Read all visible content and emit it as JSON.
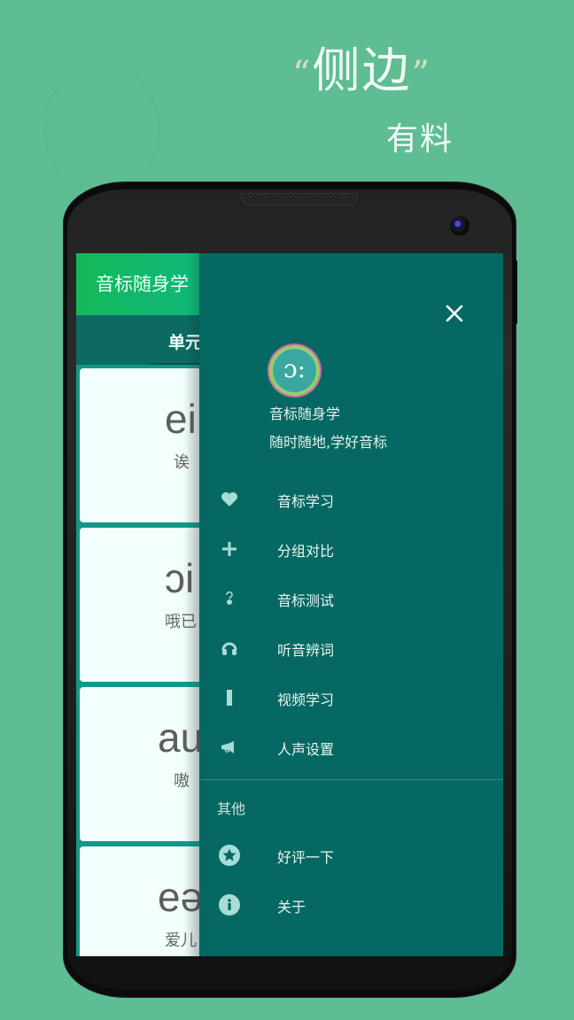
{
  "promo": {
    "open_quote": "“",
    "headline": "侧边",
    "close_quote": "”",
    "subline": "有料"
  },
  "app": {
    "title": "音标随身学",
    "tab_label": "单元",
    "cards": [
      {
        "ipa": "ei",
        "hint": "诶"
      },
      {
        "ipa": "ɔi",
        "hint": "哦已"
      },
      {
        "ipa": "au",
        "hint": "嗷"
      },
      {
        "ipa": "eə",
        "hint": "爱儿"
      }
    ]
  },
  "drawer": {
    "close_icon": "close-icon",
    "logo_glyph": "ɔ:",
    "app_name": "音标随身学",
    "slogan": "随时随地,学好音标",
    "menu": [
      {
        "icon": "heart-icon",
        "label": "音标学习"
      },
      {
        "icon": "plus-icon",
        "label": "分组对比"
      },
      {
        "icon": "question-icon",
        "label": "音标测试"
      },
      {
        "icon": "headphones-icon",
        "label": "听音辨词"
      },
      {
        "icon": "video-bar-icon",
        "label": "视频学习"
      },
      {
        "icon": "megaphone-icon",
        "label": "人声设置"
      }
    ],
    "section_title": "其他",
    "other_menu": [
      {
        "icon": "star-icon",
        "label": "好评一下"
      },
      {
        "icon": "info-icon",
        "label": "关于"
      }
    ]
  },
  "colors": {
    "background": "#5fbd93",
    "drawer": "#066862",
    "app_bar": "#14b859",
    "icon_tint": "#a8dcd6"
  }
}
